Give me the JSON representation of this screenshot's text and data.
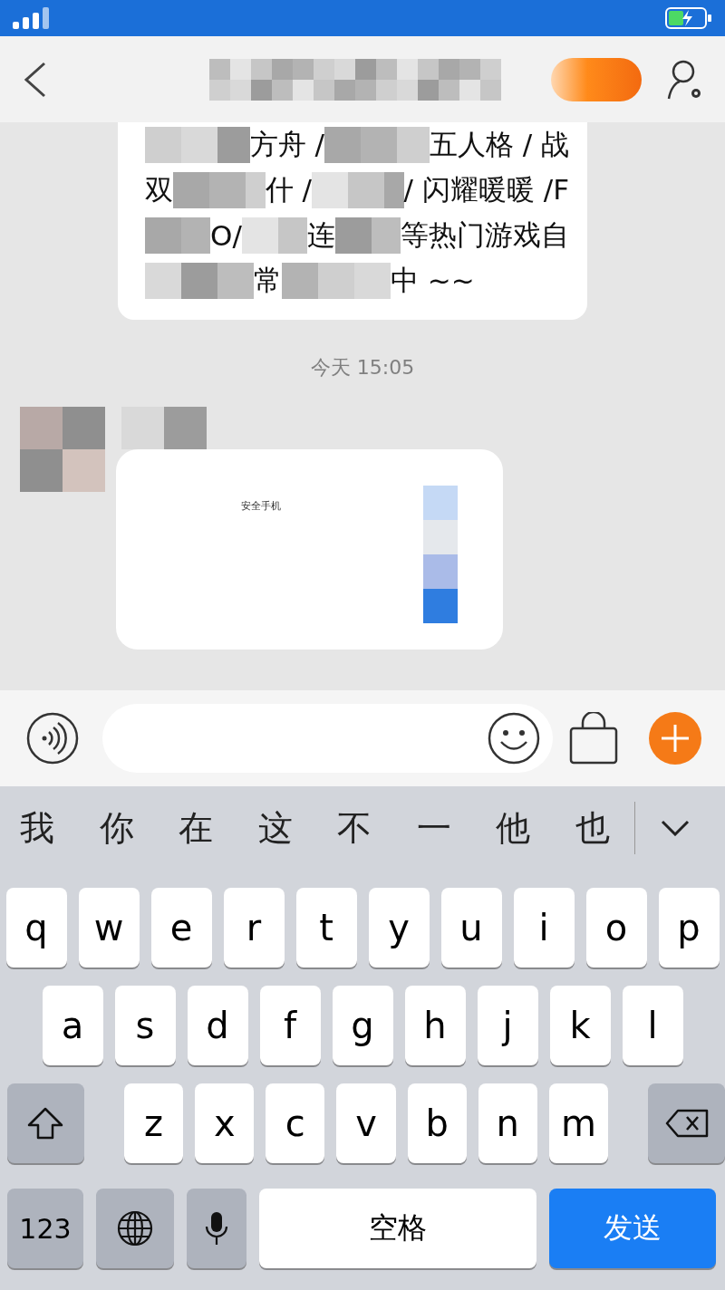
{
  "messages": [
    {
      "kind": "text",
      "lines": [
        [
          {
            "kind": "mosaic"
          },
          {
            "kind": "text",
            "text": "方舟 /"
          },
          {
            "kind": "mosaic"
          },
          {
            "kind": "text",
            "text": "五人格 / 战"
          }
        ],
        [
          {
            "kind": "text",
            "text": "双"
          },
          {
            "kind": "mosaic"
          },
          {
            "kind": "text",
            "text": "什 /"
          },
          {
            "kind": "mosaic"
          },
          {
            "kind": "text",
            "text": "/ 闪耀暖暖 /F"
          }
        ],
        [
          {
            "kind": "mosaic"
          },
          {
            "kind": "text",
            "text": "O/"
          },
          {
            "kind": "mosaic"
          },
          {
            "kind": "text",
            "text": "连"
          },
          {
            "kind": "mosaic"
          },
          {
            "kind": "text",
            "text": "等热门游戏自"
          }
        ],
        [
          {
            "kind": "mosaic"
          },
          {
            "kind": "text",
            "text": "常"
          },
          {
            "kind": "mosaic"
          },
          {
            "kind": "text",
            "text": "中 ~~"
          }
        ]
      ]
    },
    {
      "kind": "timestamp",
      "text": "今天 15:05"
    },
    {
      "kind": "image",
      "caption": "安全手机"
    }
  ],
  "keyboard": {
    "suggestions": [
      "我",
      "你",
      "在",
      "这",
      "不",
      "一",
      "他",
      "也"
    ],
    "rows": [
      [
        "q",
        "w",
        "e",
        "r",
        "t",
        "y",
        "u",
        "i",
        "o",
        "p"
      ],
      [
        "a",
        "s",
        "d",
        "f",
        "g",
        "h",
        "j",
        "k",
        "l"
      ],
      [
        "z",
        "x",
        "c",
        "v",
        "b",
        "n",
        "m"
      ]
    ],
    "bottom_row": [
      {
        "kind": "numbers",
        "text": "123"
      },
      {
        "kind": "globe"
      },
      {
        "kind": "mic"
      },
      {
        "kind": "space",
        "text": "空格"
      },
      {
        "kind": "send",
        "text": "发送"
      }
    ]
  }
}
